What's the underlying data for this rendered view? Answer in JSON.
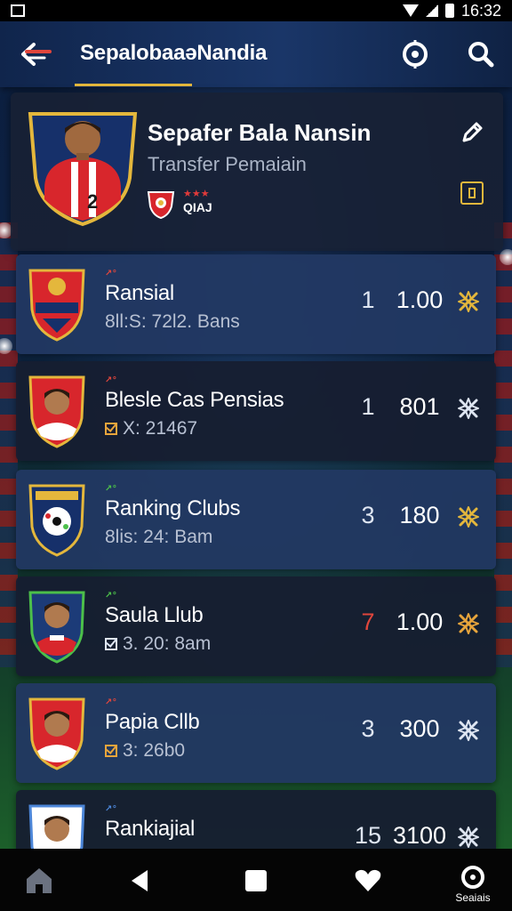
{
  "status_bar": {
    "time": "16:32"
  },
  "app_bar": {
    "title": "SepalobaaəNandia"
  },
  "profile": {
    "name": "Sepafer Bala Nansin",
    "subtitle": "Transfer Pemaiain",
    "shirt_number": "2",
    "tag_code": "QIAJ",
    "tag_stars": "★★★"
  },
  "list": [
    {
      "mini": "↗°",
      "mini_color": "#e0463c",
      "title": "Ransial",
      "sub": "8ll:S: 72l2. Bans",
      "check": "none",
      "rank": "1",
      "rank_color": "#dfe6f2",
      "value": "1.00",
      "action_color": "#e4b73c",
      "crest": "club-red"
    },
    {
      "mini": "↗°",
      "mini_color": "#e0463c",
      "title": "Blesle Cas Pensias",
      "sub": "X: 21467",
      "check": "orange",
      "rank": "1",
      "rank_color": "#dfe6f2",
      "value": "801",
      "action_color": "#dfe6f2",
      "crest": "player-red"
    },
    {
      "mini": "↗°",
      "mini_color": "#4cc04a",
      "title": "Ranking Clubs",
      "sub": "8lis: 24: Bam",
      "check": "none",
      "rank": "3",
      "rank_color": "#dfe6f2",
      "value": "180",
      "action_color": "#e4b73c",
      "crest": "club-ball"
    },
    {
      "mini": "↗°",
      "mini_color": "#4cc04a",
      "title": "Saula Llub",
      "sub": "3. 20: 8am",
      "check": "white",
      "rank": "7",
      "rank_color": "#e0463c",
      "value": "1.00",
      "action_color": "#e8a53c",
      "crest": "player-blue"
    },
    {
      "mini": "↗°",
      "mini_color": "#e0463c",
      "title": "Papia Cllb",
      "sub": "3: 26b0",
      "check": "orange",
      "rank": "3",
      "rank_color": "#dfe6f2",
      "value": "300",
      "action_color": "#dfe6f2",
      "crest": "player-red"
    },
    {
      "mini": "↗°",
      "mini_color": "#4c86d8",
      "title": "Rankiajial",
      "sub": "",
      "check": "none",
      "rank": "15",
      "rank_color": "#dfe6f2",
      "value": "3100",
      "action_color": "#dfe6f2",
      "crest": "player-white"
    }
  ],
  "bottom_nav": {
    "last_label": "Seaiais"
  },
  "colors": {
    "accent": "#e4b73c",
    "card": "#182134",
    "row_alt": "#223862"
  }
}
